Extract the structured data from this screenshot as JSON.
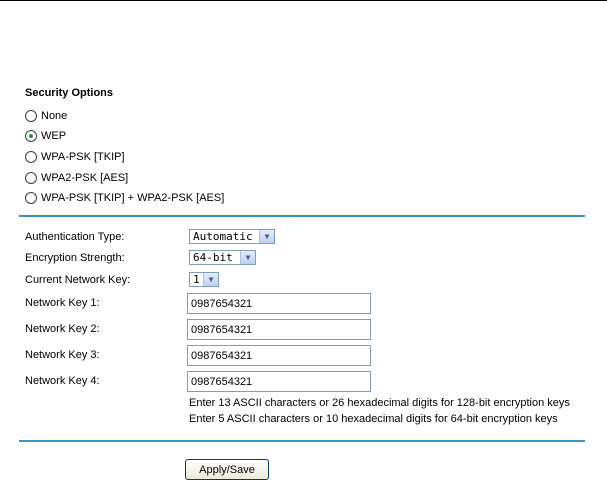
{
  "security_options": {
    "title": "Security Options",
    "options": [
      {
        "label": "None",
        "selected": false
      },
      {
        "label": "WEP",
        "selected": true
      },
      {
        "label": "WPA-PSK [TKIP]",
        "selected": false
      },
      {
        "label": "WPA2-PSK [AES]",
        "selected": false
      },
      {
        "label": "WPA-PSK [TKIP] + WPA2-PSK [AES]",
        "selected": false
      }
    ]
  },
  "settings": {
    "auth_type_label": "Authentication Type:",
    "auth_type_value": "Automatic",
    "encryption_strength_label": "Encryption Strength:",
    "encryption_strength_value": "64-bit",
    "current_key_label": "Current Network Key:",
    "current_key_value": "1",
    "keys": [
      {
        "label": "Network Key 1:",
        "value": "0987654321"
      },
      {
        "label": "Network Key 2:",
        "value": "0987654321"
      },
      {
        "label": "Network Key 3:",
        "value": "0987654321"
      },
      {
        "label": "Network Key 4:",
        "value": "0987654321"
      }
    ],
    "hint_128": "Enter 13 ASCII characters or 26 hexadecimal digits for 128-bit encryption keys",
    "hint_64": "Enter 5 ASCII characters or 10 hexadecimal digits for 64-bit encryption keys"
  },
  "actions": {
    "apply_label": "Apply/Save"
  },
  "colors": {
    "divider": "#3a94c4",
    "radio_selected": "#2e8b2e"
  }
}
